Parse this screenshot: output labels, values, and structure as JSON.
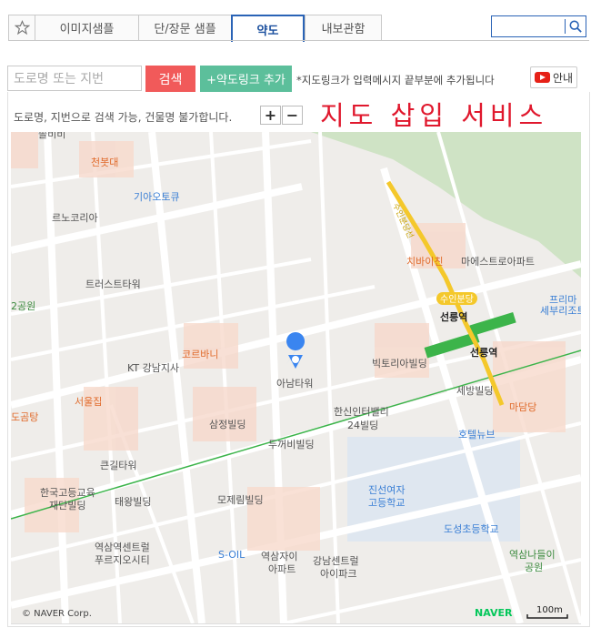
{
  "tabs": [
    {
      "label": "이미지샘플"
    },
    {
      "label": "단/장문 샘플"
    },
    {
      "label": "약도",
      "active": true
    },
    {
      "label": "내보관함"
    }
  ],
  "top_search": {
    "value": "",
    "icon": "search-icon"
  },
  "address_input": {
    "placeholder": "도로명 또는 지번",
    "value": ""
  },
  "buttons": {
    "search": "검색",
    "add_map_link": "+약도링크 추가",
    "guide": "안내"
  },
  "note": "*지도링크가 입력메시지 끝부분에 추가됩니다",
  "hint": "도로명, 지번으로 검색 가능, 건물명 불가합니다.",
  "zoom": {
    "in": "+",
    "out": "−"
  },
  "title": "지도 삽입 서비스",
  "colors": {
    "accent_blue": "#2a63b6",
    "search_red": "#f15a5a",
    "add_green": "#5cbf9b",
    "title_red": "#e0182d"
  },
  "map": {
    "copyright": "© NAVER Corp.",
    "naver": "NAVER",
    "scale": "100m",
    "labels": {
      "top_partial": "솔비비",
      "chunbong": "천봇대",
      "kia": "기아오토큐",
      "reno": "르노코리아",
      "trust": "트러스트타워",
      "gongwon2": "2공원",
      "korbani": "코르바니",
      "kt": "KT 강남지사",
      "aname": "아남타워",
      "seoul": "서울집",
      "dogom": "도곰탕",
      "samjeong": "삼정빌딩",
      "hansin": "한신인터밸리",
      "hansin2": "24빌딩",
      "dukkubi": "두꺼비빌딩",
      "keungil": "큰길타워",
      "hanguk1": "한국고등교육",
      "hanguk2": "재단빌딩",
      "taewang": "태왕빌딩",
      "moje": "모제림빌딩",
      "yeoksam_tower1": "역삼역센트럴",
      "yeoksam_tower2": "푸르지오시티",
      "soil": "S-OIL",
      "yeoksamjai1": "역삼자이",
      "yeoksamjai2": "아파트",
      "gangnam_central1": "강남센트럴",
      "gangnam_central2": "아이파크",
      "jinsun1": "진선여자",
      "jinsun2": "고등학교",
      "doseong": "도성초등학교",
      "yeoksam_park1": "역삼나들이",
      "yeoksam_park2": "공원",
      "chibai": "치바이친",
      "mareuesu": "마에스트로아파트",
      "suin_line": "수인분당선",
      "suin_badge": "수인분당",
      "seonreung": "선릉역",
      "seonreung2": "선릉역",
      "victoria": "빅토리아빌딩",
      "sebang": "세방빌딩",
      "hotel": "호텔뉴브",
      "mada": "마담당",
      "prima1": "프리마",
      "prima2": "세부리조트"
    }
  }
}
